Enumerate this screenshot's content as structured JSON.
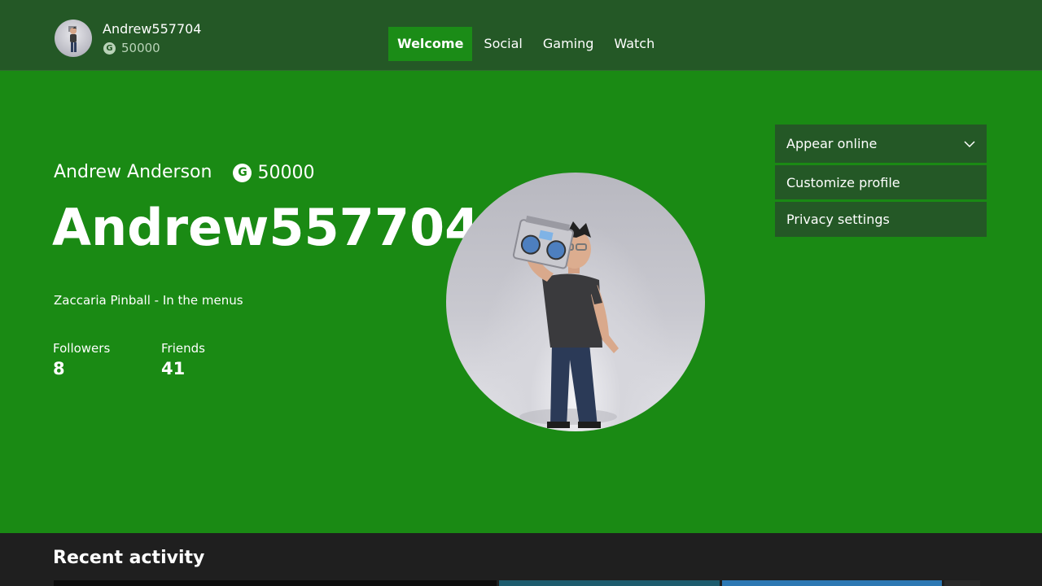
{
  "top_bar": {
    "gamertag": "Andrew557704",
    "gamerscore": "50000",
    "gamerscore_icon": "G"
  },
  "nav": {
    "tabs": [
      {
        "label": "Welcome",
        "active": true
      },
      {
        "label": "Social",
        "active": false
      },
      {
        "label": "Gaming",
        "active": false
      },
      {
        "label": "Watch",
        "active": false
      }
    ]
  },
  "profile": {
    "real_name": "Andrew Anderson",
    "gamerscore": "50000",
    "gamerscore_icon": "G",
    "gamertag": "Andrew557704",
    "presence": "Zaccaria Pinball - In the menus",
    "followers_label": "Followers",
    "followers_value": "8",
    "friends_label": "Friends",
    "friends_value": "41"
  },
  "side_menu": {
    "items": [
      {
        "label": "Appear online",
        "icon": "chevron-down-icon"
      },
      {
        "label": "Customize profile"
      },
      {
        "label": "Privacy settings"
      }
    ]
  },
  "recent_activity": {
    "title": "Recent activity"
  },
  "colors": {
    "accent_green": "#1a8a14",
    "dark_green": "#245826",
    "recent_bg": "#1f1f1f"
  }
}
